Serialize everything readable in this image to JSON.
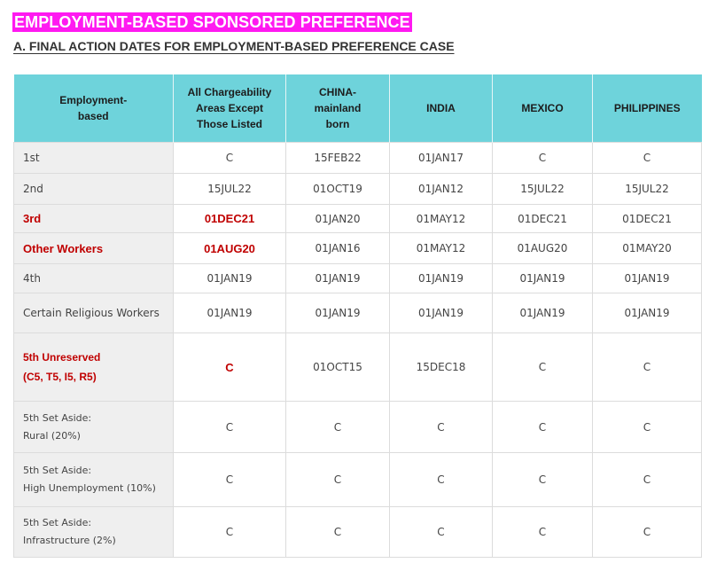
{
  "title": "EMPLOYMENT-BASED SPONSORED PREFERENCE",
  "subtitle": "A. FINAL ACTION DATES FOR EMPLOYMENT-BASED PREFERENCE CASE",
  "header": {
    "category": [
      "Employment-",
      "based"
    ],
    "all": [
      "All Chargeability",
      "Areas Except",
      "Those Listed"
    ],
    "china": [
      "CHINA-",
      "mainland",
      "born"
    ],
    "india": "INDIA",
    "mexico": "MEXICO",
    "philippines": "PHILIPPINES"
  },
  "rows": [
    {
      "label": [
        "1st"
      ],
      "all": "C",
      "china": "15FEB22",
      "india": "01JAN17",
      "mexico": "C",
      "philippines": "C"
    },
    {
      "label": [
        "2nd"
      ],
      "all": "15JUL22",
      "china": "01OCT19",
      "india": "01JAN12",
      "mexico": "15JUL22",
      "philippines": "15JUL22"
    },
    {
      "label": [
        "3rd"
      ],
      "all": "01DEC21",
      "china": "01JAN20",
      "india": "01MAY12",
      "mexico": "01DEC21",
      "philippines": "01DEC21"
    },
    {
      "label": [
        "Other Workers"
      ],
      "all": "01AUG20",
      "china": "01JAN16",
      "india": "01MAY12",
      "mexico": "01AUG20",
      "philippines": "01MAY20"
    },
    {
      "label": [
        "4th"
      ],
      "all": "01JAN19",
      "china": "01JAN19",
      "india": "01JAN19",
      "mexico": "01JAN19",
      "philippines": "01JAN19"
    },
    {
      "label": [
        "Certain Religious Workers"
      ],
      "all": "01JAN19",
      "china": "01JAN19",
      "india": "01JAN19",
      "mexico": "01JAN19",
      "philippines": "01JAN19"
    },
    {
      "label": [
        "5th Unreserved",
        "(C5, T5, I5, R5)"
      ],
      "all": "C",
      "china": "01OCT15",
      "india": "15DEC18",
      "mexico": "C",
      "philippines": "C"
    },
    {
      "label": [
        "5th Set Aside:",
        "Rural (20%)"
      ],
      "all": "C",
      "china": "C",
      "india": "C",
      "mexico": "C",
      "philippines": "C"
    },
    {
      "label": [
        "5th Set Aside:",
        "High Unemployment (10%)"
      ],
      "all": "C",
      "china": "C",
      "india": "C",
      "mexico": "C",
      "philippines": "C"
    },
    {
      "label": [
        "5th Set Aside:",
        "Infrastructure  (2%)"
      ],
      "all": "C",
      "china": "C",
      "india": "C",
      "mexico": "C",
      "philippines": "C"
    }
  ],
  "colors": {
    "banner": "#ff19f1",
    "header": "#6ed3db",
    "highlight_text": "#c00000",
    "label_bg": "#efefef"
  }
}
